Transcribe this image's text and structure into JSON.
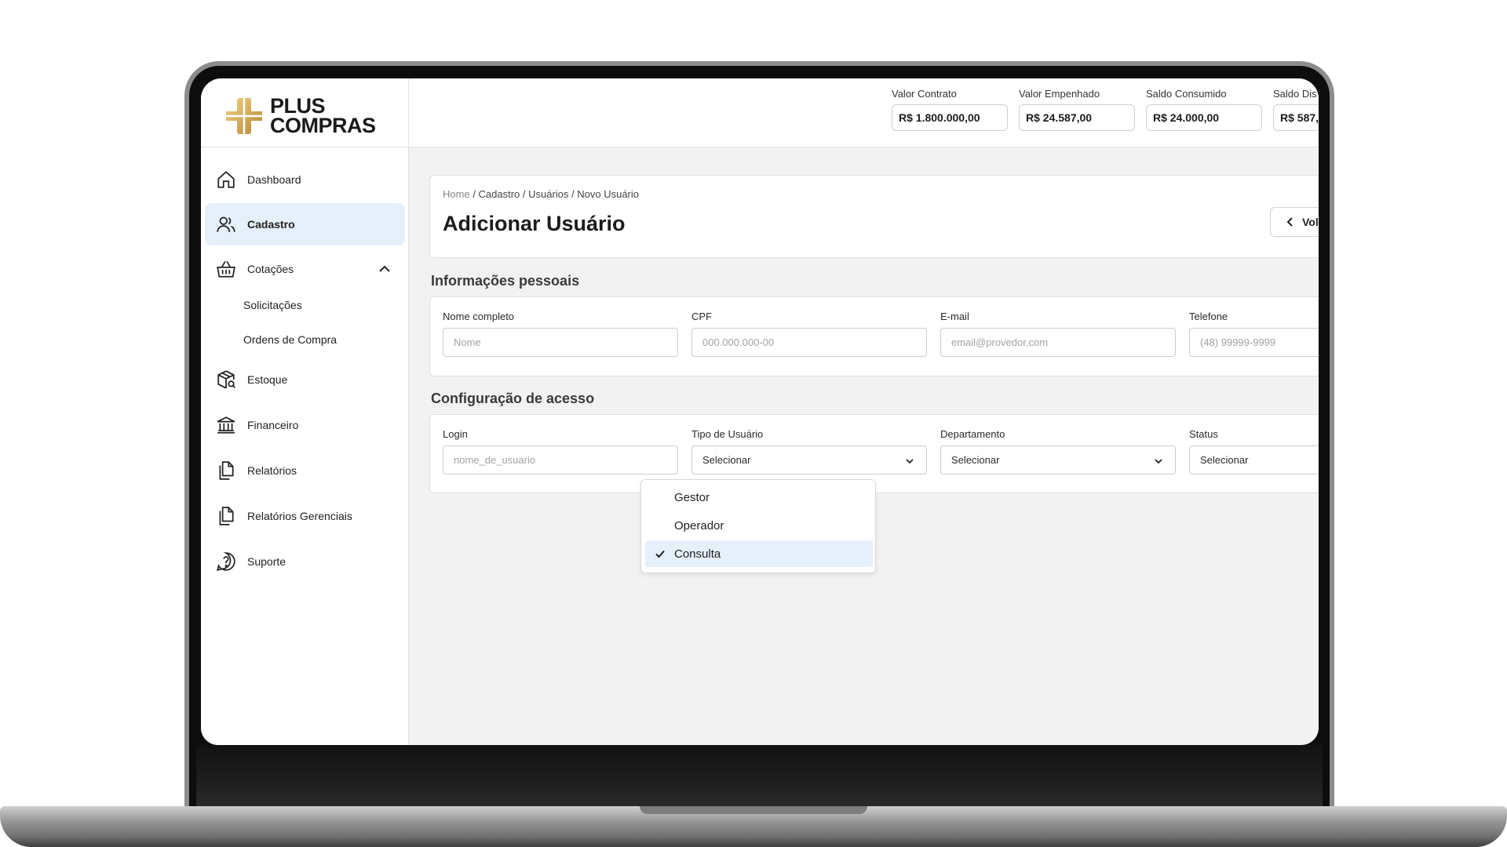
{
  "brand": {
    "line1": "PLUS",
    "line2": "COMPRAS"
  },
  "sidebar": {
    "items": [
      {
        "label": "Dashboard",
        "icon": "home-icon"
      },
      {
        "label": "Cadastro",
        "icon": "users-icon",
        "active": true
      },
      {
        "label": "Cotações",
        "icon": "basket-icon",
        "expanded": true
      },
      {
        "label": "Estoque",
        "icon": "package-search-icon"
      },
      {
        "label": "Financeiro",
        "icon": "bank-icon"
      },
      {
        "label": "Relatórios",
        "icon": "files-icon"
      },
      {
        "label": "Relatórios Gerenciais",
        "icon": "files-icon"
      },
      {
        "label": "Suporte",
        "icon": "help-circle-icon"
      }
    ],
    "cotacoes_sub": [
      "Solicitações",
      "Ordens de Compra"
    ]
  },
  "header": {
    "metrics": [
      {
        "label": "Valor Contrato",
        "value": "R$ 1.800.000,00"
      },
      {
        "label": "Valor Empenhado",
        "value": "R$ 24.587,00"
      },
      {
        "label": "Saldo Consumido",
        "value": "R$ 24.000,00"
      },
      {
        "label": "Saldo Dis",
        "value": "R$ 587,"
      }
    ]
  },
  "page": {
    "breadcrumb_home": "Home",
    "breadcrumb_rest": "/ Cadastro / Usuários / Novo Usuário",
    "title": "Adicionar Usuário",
    "back_label": "Vol"
  },
  "personal": {
    "section_title": "Informações pessoais",
    "fields": [
      {
        "label": "Nome completo",
        "placeholder": "Nome"
      },
      {
        "label": "CPF",
        "placeholder": "000.000.000-00"
      },
      {
        "label": "E-mail",
        "placeholder": "email@provedor.com"
      },
      {
        "label": "Telefone",
        "placeholder": "(48) 99999-9999"
      }
    ]
  },
  "access": {
    "section_title": "Configuração de acesso",
    "login": {
      "label": "Login",
      "placeholder": "nome_de_usuario"
    },
    "tipo": {
      "label": "Tipo de Usuário",
      "value": "Selecionar"
    },
    "departamento": {
      "label": "Departamento",
      "value": "Selecionar"
    },
    "status": {
      "label": "Status",
      "value": "Selecionar"
    }
  },
  "dropdown": {
    "options": [
      "Gestor",
      "Operador",
      "Consulta"
    ],
    "selected": "Consulta"
  },
  "colors": {
    "accent_bg": "#e6f0fb",
    "logo_gold": "#c9a24a",
    "page_bg": "#f2f2f2"
  }
}
